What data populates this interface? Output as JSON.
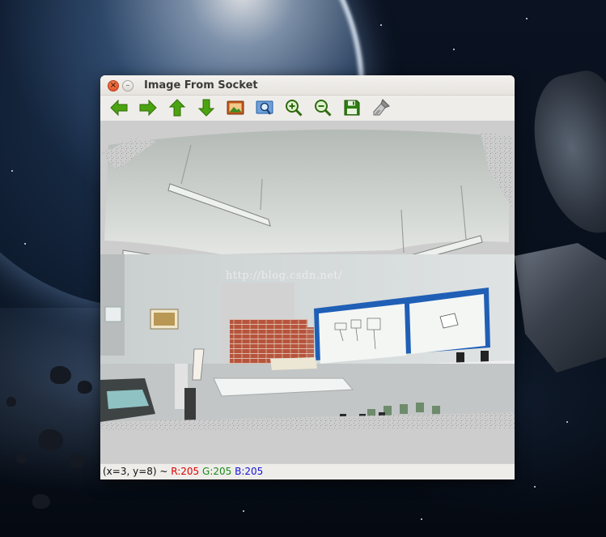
{
  "window": {
    "title": "Image From Socket",
    "controls": {
      "close_glyph": "×",
      "minimize_glyph": "–"
    }
  },
  "toolbar": {
    "buttons": [
      {
        "icon": "arrow-left-icon",
        "color": "#4ca311"
      },
      {
        "icon": "arrow-right-icon",
        "color": "#4ca311"
      },
      {
        "icon": "arrow-up-icon",
        "color": "#4ca311"
      },
      {
        "icon": "arrow-down-icon",
        "color": "#4ca311"
      },
      {
        "icon": "image-icon",
        "color": "#c2571c"
      },
      {
        "icon": "zoom-fit-icon",
        "color": "#1f5fa8"
      },
      {
        "icon": "zoom-in-icon",
        "color": "#2e6a0f"
      },
      {
        "icon": "zoom-out-icon",
        "color": "#2e6a0f"
      },
      {
        "icon": "save-icon",
        "color": "#2e7d10"
      },
      {
        "icon": "brush-icon",
        "color": "#7a7a7a"
      }
    ]
  },
  "image": {
    "watermark": "http://blog.csdn.net/"
  },
  "status": {
    "coords": "(x=3, y=8) ~ ",
    "r": "R:205",
    "g": "G:205",
    "b": "B:205",
    "colors": {
      "r": "#e00000",
      "g": "#1a8a1a",
      "b": "#1414d8"
    }
  }
}
